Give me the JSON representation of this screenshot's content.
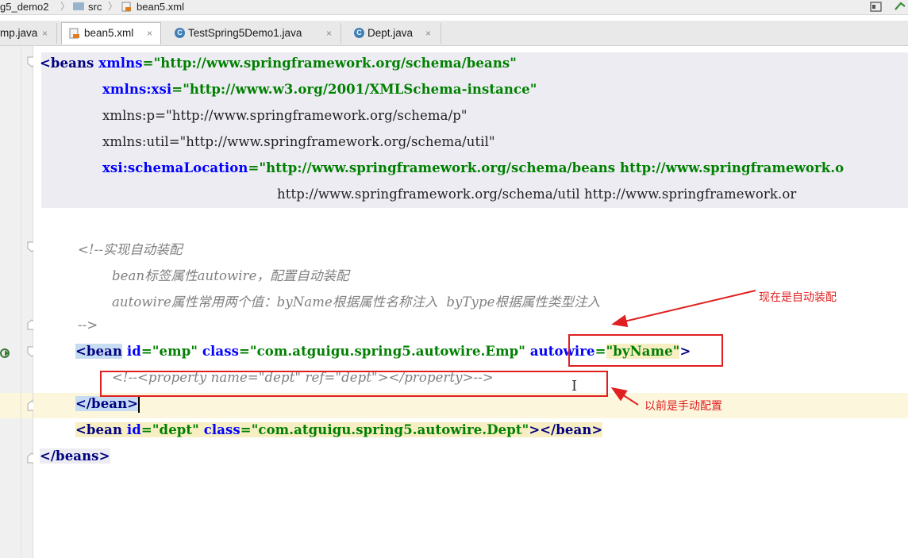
{
  "breadcrumb": {
    "project": "g5_demo2",
    "folder": "src",
    "file": "bean5.xml"
  },
  "tabs": [
    {
      "label": "mp.java",
      "active": false
    },
    {
      "label": "bean5.xml",
      "active": true
    },
    {
      "label": "TestSpring5Demo1.java",
      "active": false
    },
    {
      "label": "Dept.java",
      "active": false
    }
  ],
  "tab_close_glyph": "×",
  "code": {
    "l1_open": "<beans ",
    "l1_attr": "xmlns",
    "l1_eq": "=",
    "l1_val": "\"http://www.springframework.org/schema/beans\"",
    "l2_attr": "xmlns:xsi",
    "l2_eq": "=",
    "l2_val": "\"http://www.w3.org/2001/XMLSchema-instance\"",
    "l3": "xmlns:p=\"http://www.springframework.org/schema/p\"",
    "l4": "xmlns:util=\"http://www.springframework.org/schema/util\"",
    "l5_attr": "xsi:schemaLocation",
    "l5_eq": "=",
    "l5_val": "\"http://www.springframework.org/schema/beans http://www.springframework.o",
    "l6": "http://www.springframework.org/schema/util http://www.springframework.or",
    "c1": "<!--实现自动装配",
    "c2": "bean标签属性autowire，配置自动装配",
    "c3": "autowire属性常用两个值：byName根据属性名称注入  byType根据属性类型注入",
    "c4": "-->",
    "b1_tag": "<bean",
    "b1_id_attr": " id",
    "b1_eq": "=",
    "b1_id_val": "\"emp\"",
    "b1_class_attr": " class",
    "b1_class_val": "\"com.atguigu.spring5.autowire.Emp\"",
    "b1_aw_attr": " autowire",
    "b1_aw_val": "\"byName\"",
    "b1_close": ">",
    "b2_comment": "<!--<property name=\"dept\" ref=\"dept\"></property>-->",
    "b3": "</bean>",
    "b4_tag": "<bean",
    "b4_id_attr": " id",
    "b4_id_val": "\"dept\"",
    "b4_class_attr": " class",
    "b4_class_val": "\"com.atguigu.spring5.autowire.Dept\"",
    "b4_end": "></bean>",
    "l_end": "</beans>"
  },
  "annotations": {
    "now": "现在是自动装配",
    "before": "以前是手动配置"
  },
  "colors": {
    "annotation_red": "#e02020",
    "xml_tag": "#000080",
    "xml_attr": "#0000ff",
    "xml_value": "#008000",
    "comment": "#808080"
  }
}
